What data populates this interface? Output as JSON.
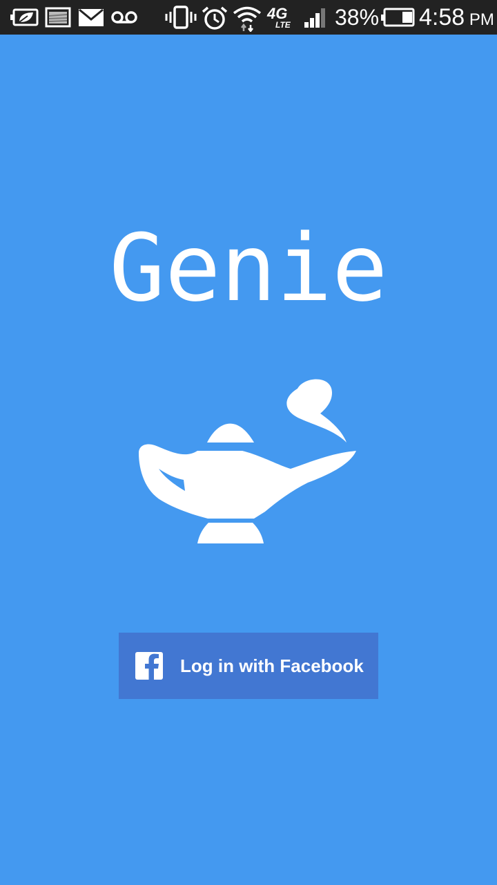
{
  "status_bar": {
    "icons": [
      "battery-saver-icon",
      "image-icon",
      "mail-icon",
      "voicemail-icon",
      "vibrate-icon",
      "alarm-icon",
      "wifi-icon",
      "network-4g-lte-icon",
      "signal-icon",
      "battery-icon"
    ],
    "network_label": "4G",
    "network_sub_label": "LTE",
    "battery_percent": "38%",
    "battery_level": 0.38,
    "time": "4:58",
    "ampm": "PM"
  },
  "app": {
    "title": "Genie",
    "logo_icon": "magic-lamp-icon"
  },
  "login": {
    "facebook_label": "Log in with Facebook",
    "facebook_icon": "facebook-icon"
  },
  "colors": {
    "background": "#4499F0",
    "status_bar": "#222222",
    "facebook_button": "#4277D2",
    "foreground": "#FFFFFF"
  }
}
